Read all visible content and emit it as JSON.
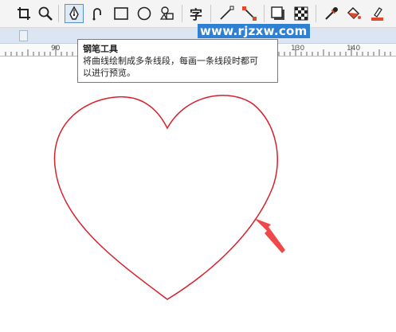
{
  "toolbar": {
    "tools": [
      {
        "name": "crop-tool"
      },
      {
        "name": "zoom-tool"
      },
      {
        "name": "pen-tool",
        "active": true
      },
      {
        "name": "freehand-tool"
      },
      {
        "name": "rectangle-tool"
      },
      {
        "name": "ellipse-tool"
      },
      {
        "name": "shape-tool"
      },
      {
        "name": "text-tool",
        "label": "字"
      },
      {
        "name": "line-tool"
      },
      {
        "name": "connector-tool"
      },
      {
        "name": "drop-shadow-tool"
      },
      {
        "name": "transparency-tool"
      },
      {
        "name": "eyedropper-tool"
      },
      {
        "name": "fill-tool"
      },
      {
        "name": "outline-tool"
      }
    ]
  },
  "ruler": {
    "labels": [
      "90",
      "130",
      "140"
    ]
  },
  "watermark": "www.rjzxw.com",
  "tooltip": {
    "title": "钢笔工具",
    "line1": "将曲线绘制成多条线段，每画一条线段时都可",
    "line2": "以进行预览。"
  },
  "colors": {
    "heart_stroke": "#d8202c",
    "arrow": "#f04848",
    "active_border": "#5a8fcf"
  }
}
